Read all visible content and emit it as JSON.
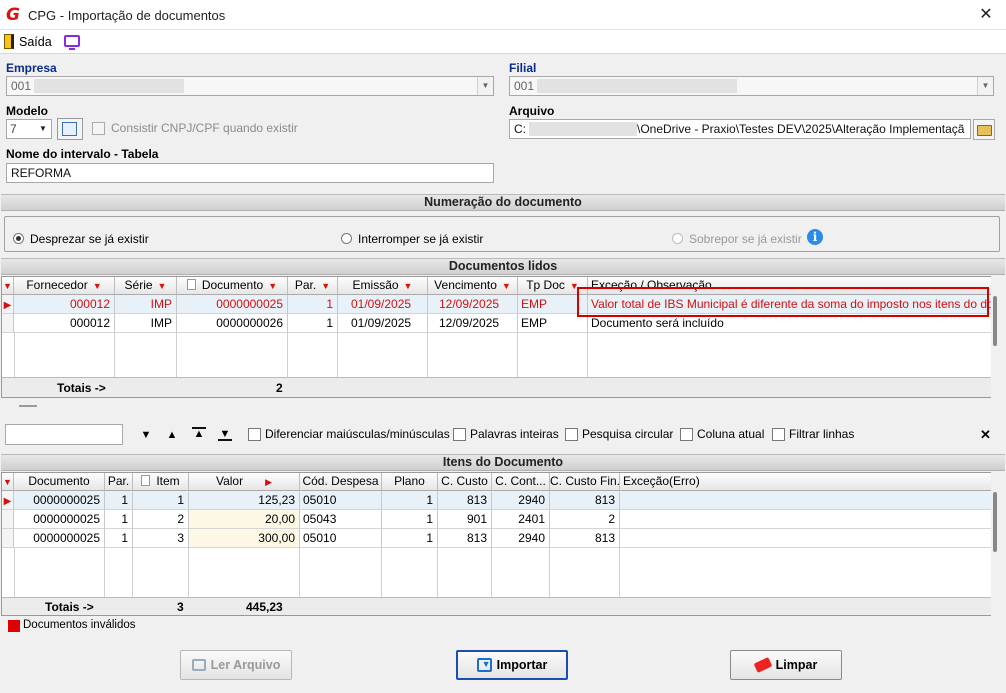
{
  "window": {
    "title": "CPG - Importação de documentos",
    "close_glyph": "✕",
    "logo_glyph": "G"
  },
  "menu": {
    "exit_label": "Saída"
  },
  "form": {
    "empresa_label": "Empresa",
    "empresa_value": "001",
    "filial_label": "Filial",
    "filial_value": "001",
    "modelo_label": "Modelo",
    "modelo_value": "7",
    "consistir_label": "Consistir CNPJ/CPF quando existir",
    "arquivo_label": "Arquivo",
    "arquivo_prefix": "C:",
    "arquivo_value": "\\OneDrive - Praxio\\Testes DEV\\2025\\Alteração Implementaçã",
    "intervalo_label": "Nome do intervalo - Tabela",
    "intervalo_value": "REFORMA"
  },
  "numeracao": {
    "title": "Numeração do documento",
    "opt1": "Desprezar se já existir",
    "opt2": "Interromper se já existir",
    "opt3": "Sobrepor se já existir"
  },
  "docs": {
    "title": "Documentos lidos",
    "headers": [
      "Fornecedor",
      "Série",
      "Documento",
      "Par.",
      "Emissão",
      "Vencimento",
      "Tp Doc",
      "Exceção / Observação"
    ],
    "rows": [
      [
        "000012",
        "IMP",
        "0000000025",
        "1",
        "01/09/2025",
        "12/09/2025",
        "EMP",
        "Valor total de IBS Municipal é diferente da soma do imposto nos itens do doc"
      ],
      [
        "000012",
        "IMP",
        "0000000026",
        "1",
        "01/09/2025",
        "12/09/2025",
        "EMP",
        "Documento será incluído"
      ]
    ],
    "totals_label": "Totais ->",
    "totals_count": "2"
  },
  "search": {
    "value": "",
    "opt_case": "Diferenciar maiúsculas/minúsculas",
    "opt_words": "Palavras inteiras",
    "opt_circular": "Pesquisa circular",
    "opt_column": "Coluna atual",
    "opt_filter": "Filtrar linhas",
    "close_glyph": "✕"
  },
  "itens": {
    "title": "Itens do Documento",
    "headers": [
      "Documento",
      "Par.",
      "Item",
      "Valor",
      "Cód. Despesa",
      "Plano",
      "C. Custo",
      "C. Cont...",
      "C. Custo Fin.",
      "Exceção(Erro)"
    ],
    "rows": [
      [
        "0000000025",
        "1",
        "1",
        "125,23",
        "05010",
        "1",
        "813",
        "2940",
        "813",
        ""
      ],
      [
        "0000000025",
        "1",
        "2",
        "20,00",
        "05043",
        "1",
        "901",
        "2401",
        "2",
        ""
      ],
      [
        "0000000025",
        "1",
        "3",
        "300,00",
        "05010",
        "1",
        "813",
        "2940",
        "813",
        ""
      ]
    ],
    "totals_label": "Totais ->",
    "totals_count": "3",
    "totals_value": "445,23"
  },
  "legend": {
    "invalid_label": "Documentos inválidos",
    "invalid_color": "#e00000"
  },
  "buttons": {
    "ler": "Ler Arquivo",
    "importar": "Importar",
    "limpar": "Limpar"
  },
  "colors": {
    "error_text": "#d41010",
    "highlight_border": "#d40000",
    "accent": "#0a2c8c"
  }
}
